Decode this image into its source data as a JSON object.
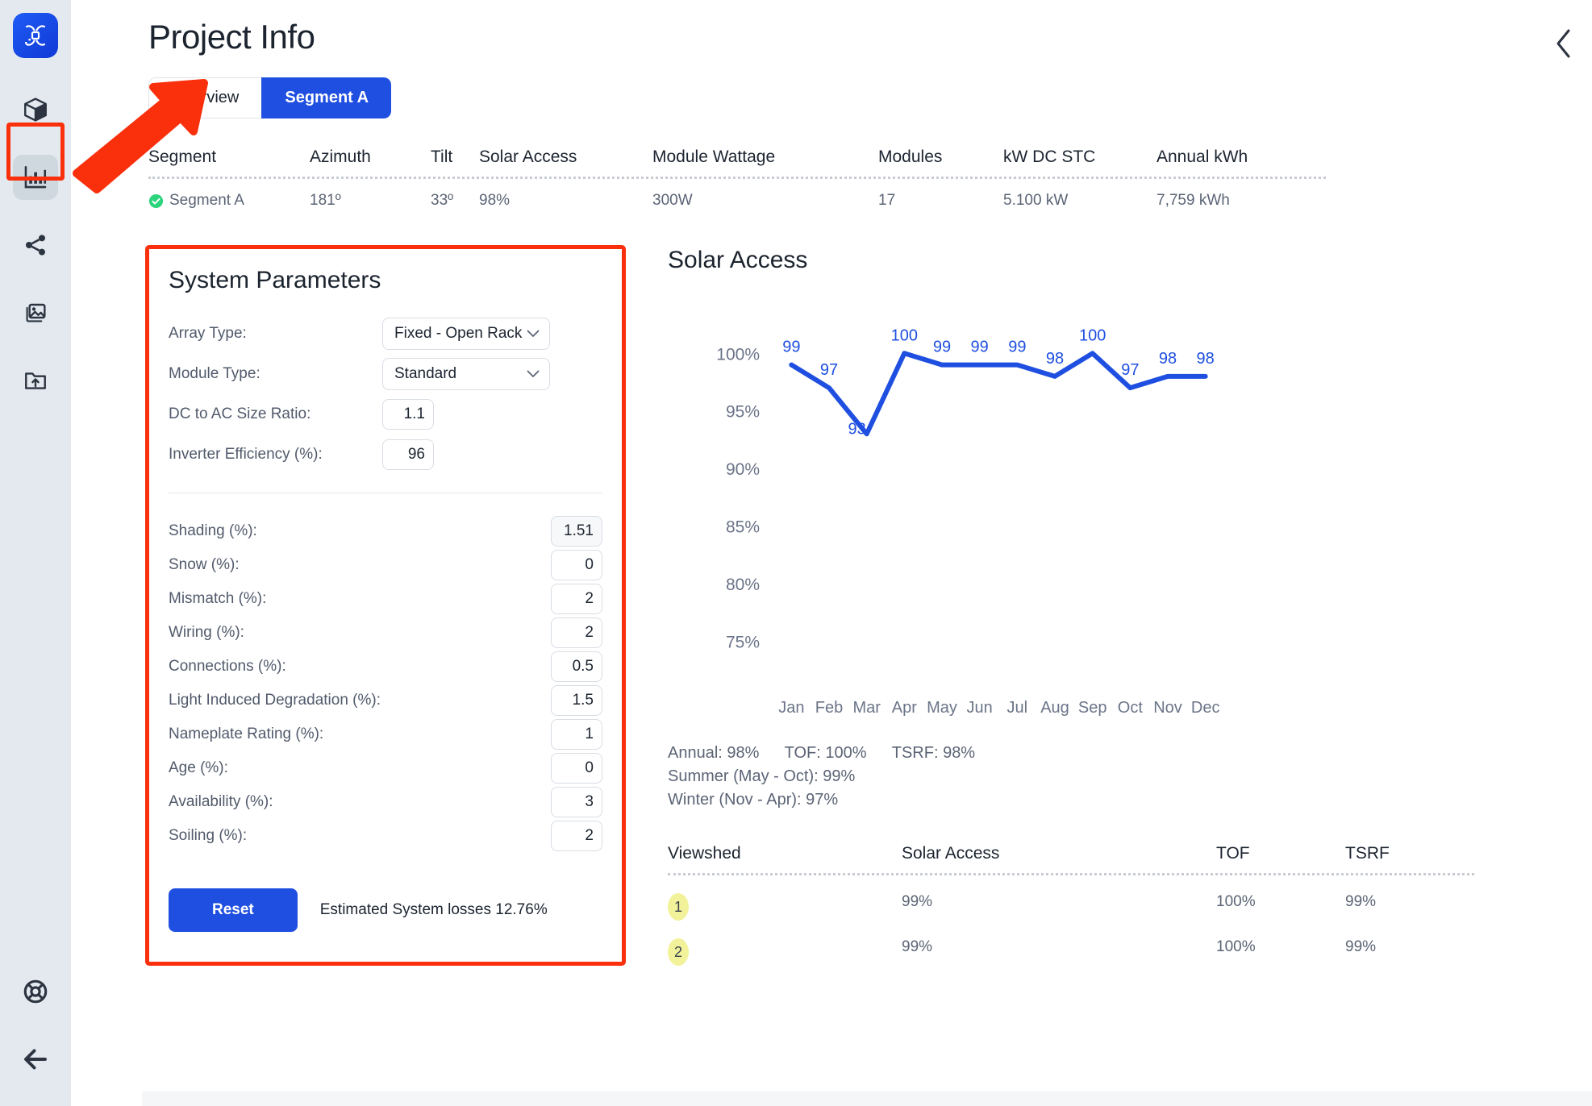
{
  "app": {
    "title": "Project Info",
    "logo_icon": "drone-logo-icon",
    "collapse_icon": "chevron-left-icon"
  },
  "sidebar": {
    "items": [
      {
        "label": "3D Model",
        "icon": "cube-icon",
        "active": false
      },
      {
        "label": "Analytics",
        "icon": "bar-chart-icon",
        "active": true
      },
      {
        "label": "Share",
        "icon": "share-icon",
        "active": false
      },
      {
        "label": "Images",
        "icon": "images-icon",
        "active": false
      },
      {
        "label": "Upload",
        "icon": "folder-upload-icon",
        "active": false
      }
    ],
    "bottom_items": [
      {
        "label": "Help",
        "icon": "lifebuoy-icon"
      },
      {
        "label": "Back",
        "icon": "arrow-left-icon"
      }
    ]
  },
  "tabs": [
    {
      "label": "Overview",
      "active": false
    },
    {
      "label": "Segment A",
      "active": true
    }
  ],
  "segment_table": {
    "headers": [
      "Segment",
      "Azimuth",
      "Tilt",
      "Solar Access",
      "Module Wattage",
      "Modules",
      "kW DC STC",
      "Annual kWh"
    ],
    "rows": [
      {
        "segment": "Segment A",
        "status_icon": "check-circle-icon",
        "azimuth": "181º",
        "tilt": "33º",
        "solar_access": "98%",
        "module_wattage": "300W",
        "modules": "17",
        "kw_dc_stc": "5.100 kW",
        "annual_kwh": "7,759 kWh"
      }
    ]
  },
  "system_parameters": {
    "title": "System Parameters",
    "selects": [
      {
        "label": "Array Type:",
        "value": "Fixed - Open Rack"
      },
      {
        "label": "Module Type:",
        "value": "Standard"
      }
    ],
    "numbers": [
      {
        "label": "DC to AC Size Ratio:",
        "value": "1.1"
      },
      {
        "label": "Inverter Efficiency (%):",
        "value": "96"
      }
    ],
    "losses": [
      {
        "label": "Shading (%):",
        "value": "1.51"
      },
      {
        "label": "Snow (%):",
        "value": "0"
      },
      {
        "label": "Mismatch (%):",
        "value": "2"
      },
      {
        "label": "Wiring (%):",
        "value": "2"
      },
      {
        "label": "Connections (%):",
        "value": "0.5"
      },
      {
        "label": "Light Induced Degradation (%):",
        "value": "1.5"
      },
      {
        "label": "Nameplate Rating (%):",
        "value": "1"
      },
      {
        "label": "Age (%):",
        "value": "0"
      },
      {
        "label": "Availability (%):",
        "value": "3"
      },
      {
        "label": "Soiling (%):",
        "value": "2"
      }
    ],
    "reset_label": "Reset",
    "estimated_losses": "Estimated System losses 12.76%"
  },
  "solar_access": {
    "title": "Solar Access",
    "summary": {
      "annual": "Annual: 98%",
      "tof": "TOF: 100%",
      "tsrf": "TSRF: 98%",
      "summer": "Summer (May - Oct): 99%",
      "winter": "Winter (Nov - Apr): 97%"
    },
    "viewshed_table": {
      "headers": [
        "Viewshed",
        "Solar Access",
        "TOF",
        "TSRF"
      ],
      "rows": [
        {
          "viewshed": "1",
          "solar_access": "99%",
          "tof": "100%",
          "tsrf": "99%"
        },
        {
          "viewshed": "2",
          "solar_access": "99%",
          "tof": "100%",
          "tsrf": "99%"
        }
      ]
    }
  },
  "chart_data": {
    "type": "line",
    "title": "Solar Access",
    "xlabel": "",
    "ylabel": "",
    "categories": [
      "Jan",
      "Feb",
      "Mar",
      "Apr",
      "May",
      "Jun",
      "Jul",
      "Aug",
      "Sep",
      "Oct",
      "Nov",
      "Dec"
    ],
    "values": [
      99,
      97,
      93,
      100,
      99,
      99,
      99,
      98,
      100,
      97,
      98,
      98
    ],
    "data_labels": [
      "99",
      "97",
      "93",
      "100",
      "99",
      "99",
      "99",
      "98",
      "100",
      "97",
      "98",
      "98"
    ],
    "ytick_labels": [
      "100%",
      "95%",
      "90%",
      "85%",
      "80%",
      "75%"
    ],
    "ytick_values": [
      100,
      95,
      90,
      85,
      80,
      75
    ],
    "ylim": [
      73,
      101
    ],
    "grid": false,
    "legend": "none",
    "series_color": "#1f4fe0",
    "tick_color": "#6b7488"
  },
  "colors": {
    "accent": "#1f4fe0",
    "highlight": "#fa2f0c",
    "rail_bg": "#e3e9ee",
    "badge": "#f2f29a",
    "status_green": "#2bd47d"
  }
}
